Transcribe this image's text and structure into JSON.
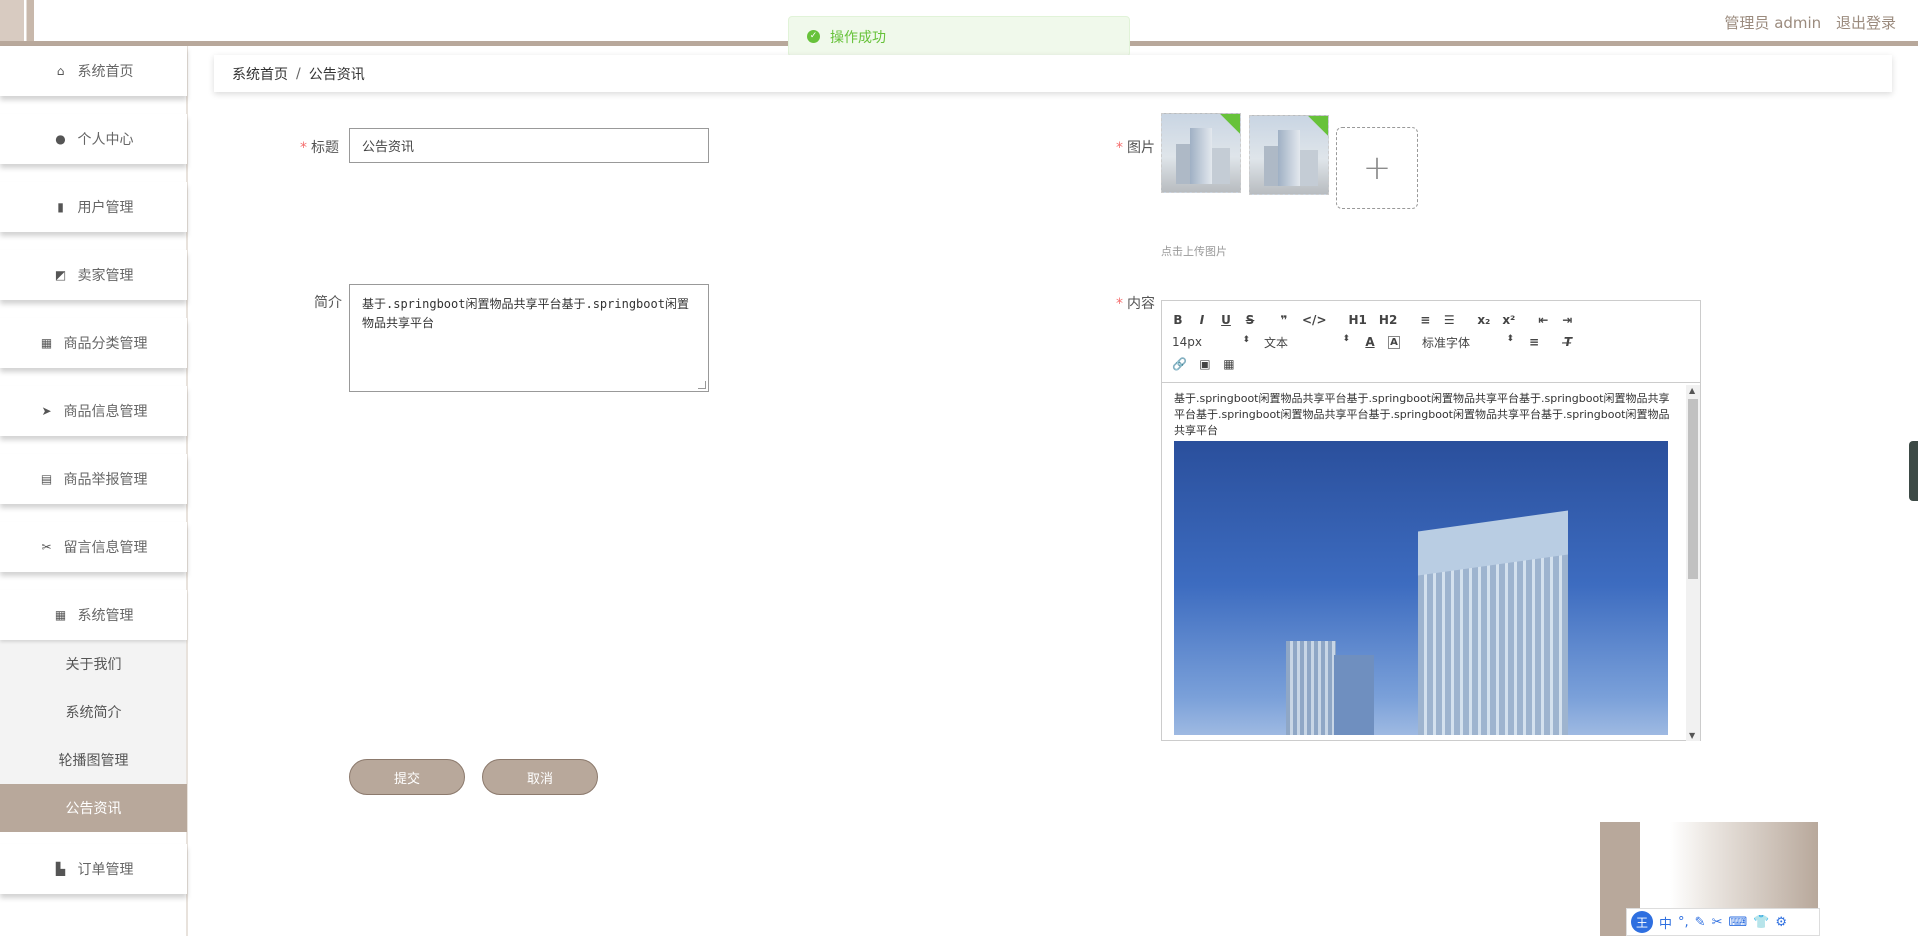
{
  "topbar": {
    "user_label": "管理员 admin",
    "logout_label": "退出登录"
  },
  "toast": {
    "message": "操作成功"
  },
  "sidebar": {
    "items": [
      {
        "label": "系统首页",
        "icon": "home-icon"
      },
      {
        "label": "个人中心",
        "icon": "user-icon"
      },
      {
        "label": "用户管理",
        "icon": "book-icon"
      },
      {
        "label": "卖家管理",
        "icon": "chart-icon"
      },
      {
        "label": "商品分类管理",
        "icon": "grid-icon"
      },
      {
        "label": "商品信息管理",
        "icon": "send-icon"
      },
      {
        "label": "商品举报管理",
        "icon": "clipboard-icon"
      },
      {
        "label": "留言信息管理",
        "icon": "ticket-icon"
      },
      {
        "label": "系统管理",
        "icon": "grid-icon"
      }
    ],
    "sub_items": [
      {
        "label": "关于我们"
      },
      {
        "label": "系统简介"
      },
      {
        "label": "轮播图管理"
      },
      {
        "label": "公告资讯",
        "active": true
      }
    ],
    "last_item": {
      "label": "订单管理",
      "icon": "cart-icon"
    }
  },
  "breadcrumb": {
    "home": "系统首页",
    "current": "公告资讯",
    "separator": "/"
  },
  "form": {
    "title_label": "标题",
    "title_value": "公告资讯",
    "intro_label": "简介",
    "intro_value": "基于.springboot闲置物品共享平台基于.springboot闲置物品共享平台",
    "image_label": "图片",
    "upload_hint": "点击上传图片",
    "content_label": "内容",
    "required_mark": "*"
  },
  "editor": {
    "toolbar_row1": [
      "B",
      "I",
      "U",
      "S",
      "❞",
      "</>",
      "H1",
      "H2",
      "≡",
      "☰",
      "x₂",
      "x²",
      "⇤",
      "⇥"
    ],
    "font_size": "14px",
    "text_type": "文本",
    "font_family": "标准字体",
    "content_text": "基于.springboot闲置物品共享平台基于.springboot闲置物品共享平台基于.springboot闲置物品共享平台基于.springboot闲置物品共享平台基于.springboot闲置物品共享平台基于.springboot闲置物品共享平台"
  },
  "buttons": {
    "submit": "提交",
    "cancel": "取消"
  },
  "ime": {
    "badge": "王",
    "lang": "中"
  },
  "colors": {
    "accent": "#b8a89b",
    "success": "#67c23a",
    "required": "#f56c6c"
  }
}
